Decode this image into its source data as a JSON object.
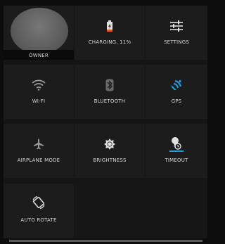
{
  "tiles": {
    "owner": {
      "label": "OWNER"
    },
    "charging": {
      "label": "CHARGING, 11%",
      "icon": "battery-charging-icon",
      "color": "#e8542a"
    },
    "settings": {
      "label": "SETTINGS",
      "icon": "settings-sliders-icon"
    },
    "wifi": {
      "label": "WI-FI",
      "icon": "wifi-icon"
    },
    "bluetooth": {
      "label": "BLUETOOTH",
      "icon": "bluetooth-icon"
    },
    "gps": {
      "label": "GPS",
      "icon": "gps-icon",
      "color": "#1a9fe0"
    },
    "airplane": {
      "label": "AIRPLANE MODE",
      "icon": "airplane-icon"
    },
    "brightness": {
      "label": "BRIGHTNESS",
      "icon": "brightness-icon"
    },
    "timeout": {
      "label": "TIMEOUT",
      "icon": "timeout-icon"
    },
    "auto_rotate": {
      "label": "AUTO ROTATE",
      "icon": "auto-rotate-icon"
    }
  },
  "colors": {
    "background": "#0d0d0d",
    "tile": "#1c1c1c",
    "accent": "#1a9fe0",
    "battery": "#e8542a"
  }
}
